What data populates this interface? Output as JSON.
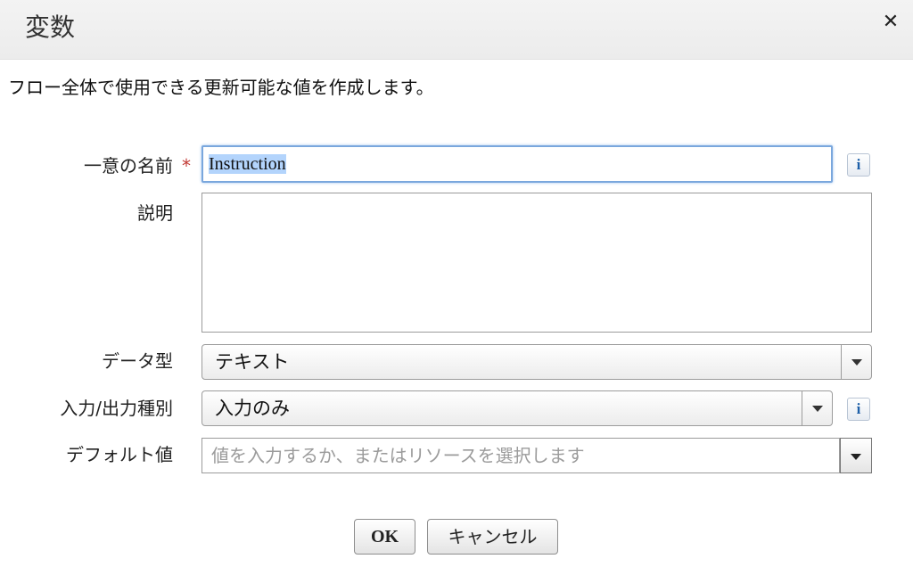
{
  "dialog": {
    "title": "変数",
    "close_symbol": "✕",
    "description": "フロー全体で使用できる更新可能な値を作成します。"
  },
  "form": {
    "unique_name": {
      "label": "一意の名前",
      "required_marker": "*",
      "value": "Instruction",
      "info_glyph": "i"
    },
    "description": {
      "label": "説明",
      "value": ""
    },
    "data_type": {
      "label": "データ型",
      "selected": "テキスト"
    },
    "io_type": {
      "label": "入力/出力種別",
      "selected": "入力のみ",
      "info_glyph": "i"
    },
    "default_value": {
      "label": "デフォルト値",
      "placeholder": "値を入力するか、またはリソースを選択します"
    }
  },
  "buttons": {
    "ok_label": "OK",
    "cancel_label": "キャンセル"
  },
  "colors": {
    "required": "#c23934",
    "focus_border": "#7aa7dd",
    "selection": "#b3d4fc",
    "info_icon": "#1d5fa8"
  },
  "icons": {
    "close": "close-icon",
    "info": "info-icon",
    "dropdown": "chevron-down-icon"
  }
}
